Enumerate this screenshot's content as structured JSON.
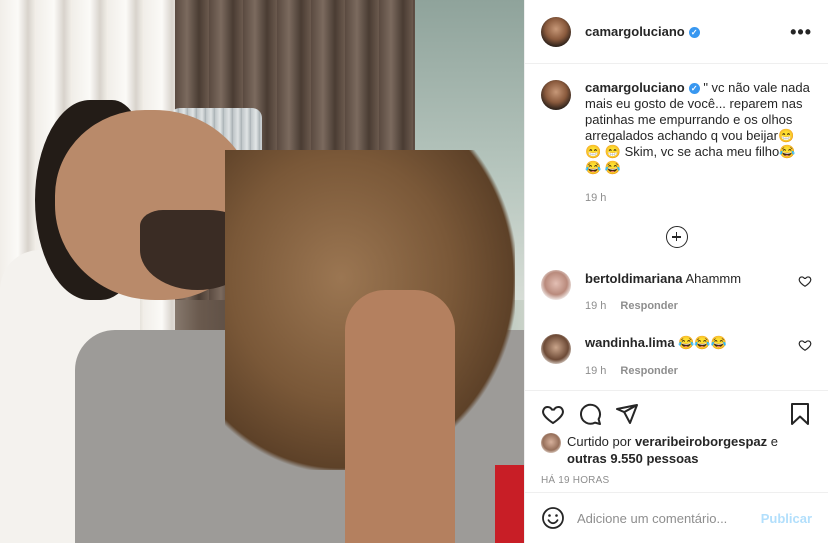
{
  "post": {
    "username": "camargoluciano",
    "more_label": "•••",
    "caption_text": "\" vc não vale nada mais eu gosto de você... reparem nas patinhas me empurrando e os olhos arregalados achando q vou beijar😁 😁 😁 Skim, vc se acha meu filho😂 😂 😂",
    "caption_time": "19 h"
  },
  "comments": [
    {
      "username": "bertoldimariana",
      "text": "Ahammm",
      "time": "19 h",
      "reply_label": "Responder"
    },
    {
      "username": "wandinha.lima",
      "text": "😂😂😂",
      "time": "19 h",
      "reply_label": "Responder"
    }
  ],
  "likes": {
    "prefix": "Curtido por",
    "liker": "veraribeiroborgespaz",
    "connector": "e",
    "others": "outras 9.550 pessoas"
  },
  "timestamp": "HÁ 19 HORAS",
  "comment_box": {
    "placeholder": "Adicione um comentário...",
    "publish_label": "Publicar"
  },
  "colors": {
    "verified": "#3897f0",
    "publish_disabled": "#b2dffc",
    "meta_gray": "#8e8e8e"
  }
}
